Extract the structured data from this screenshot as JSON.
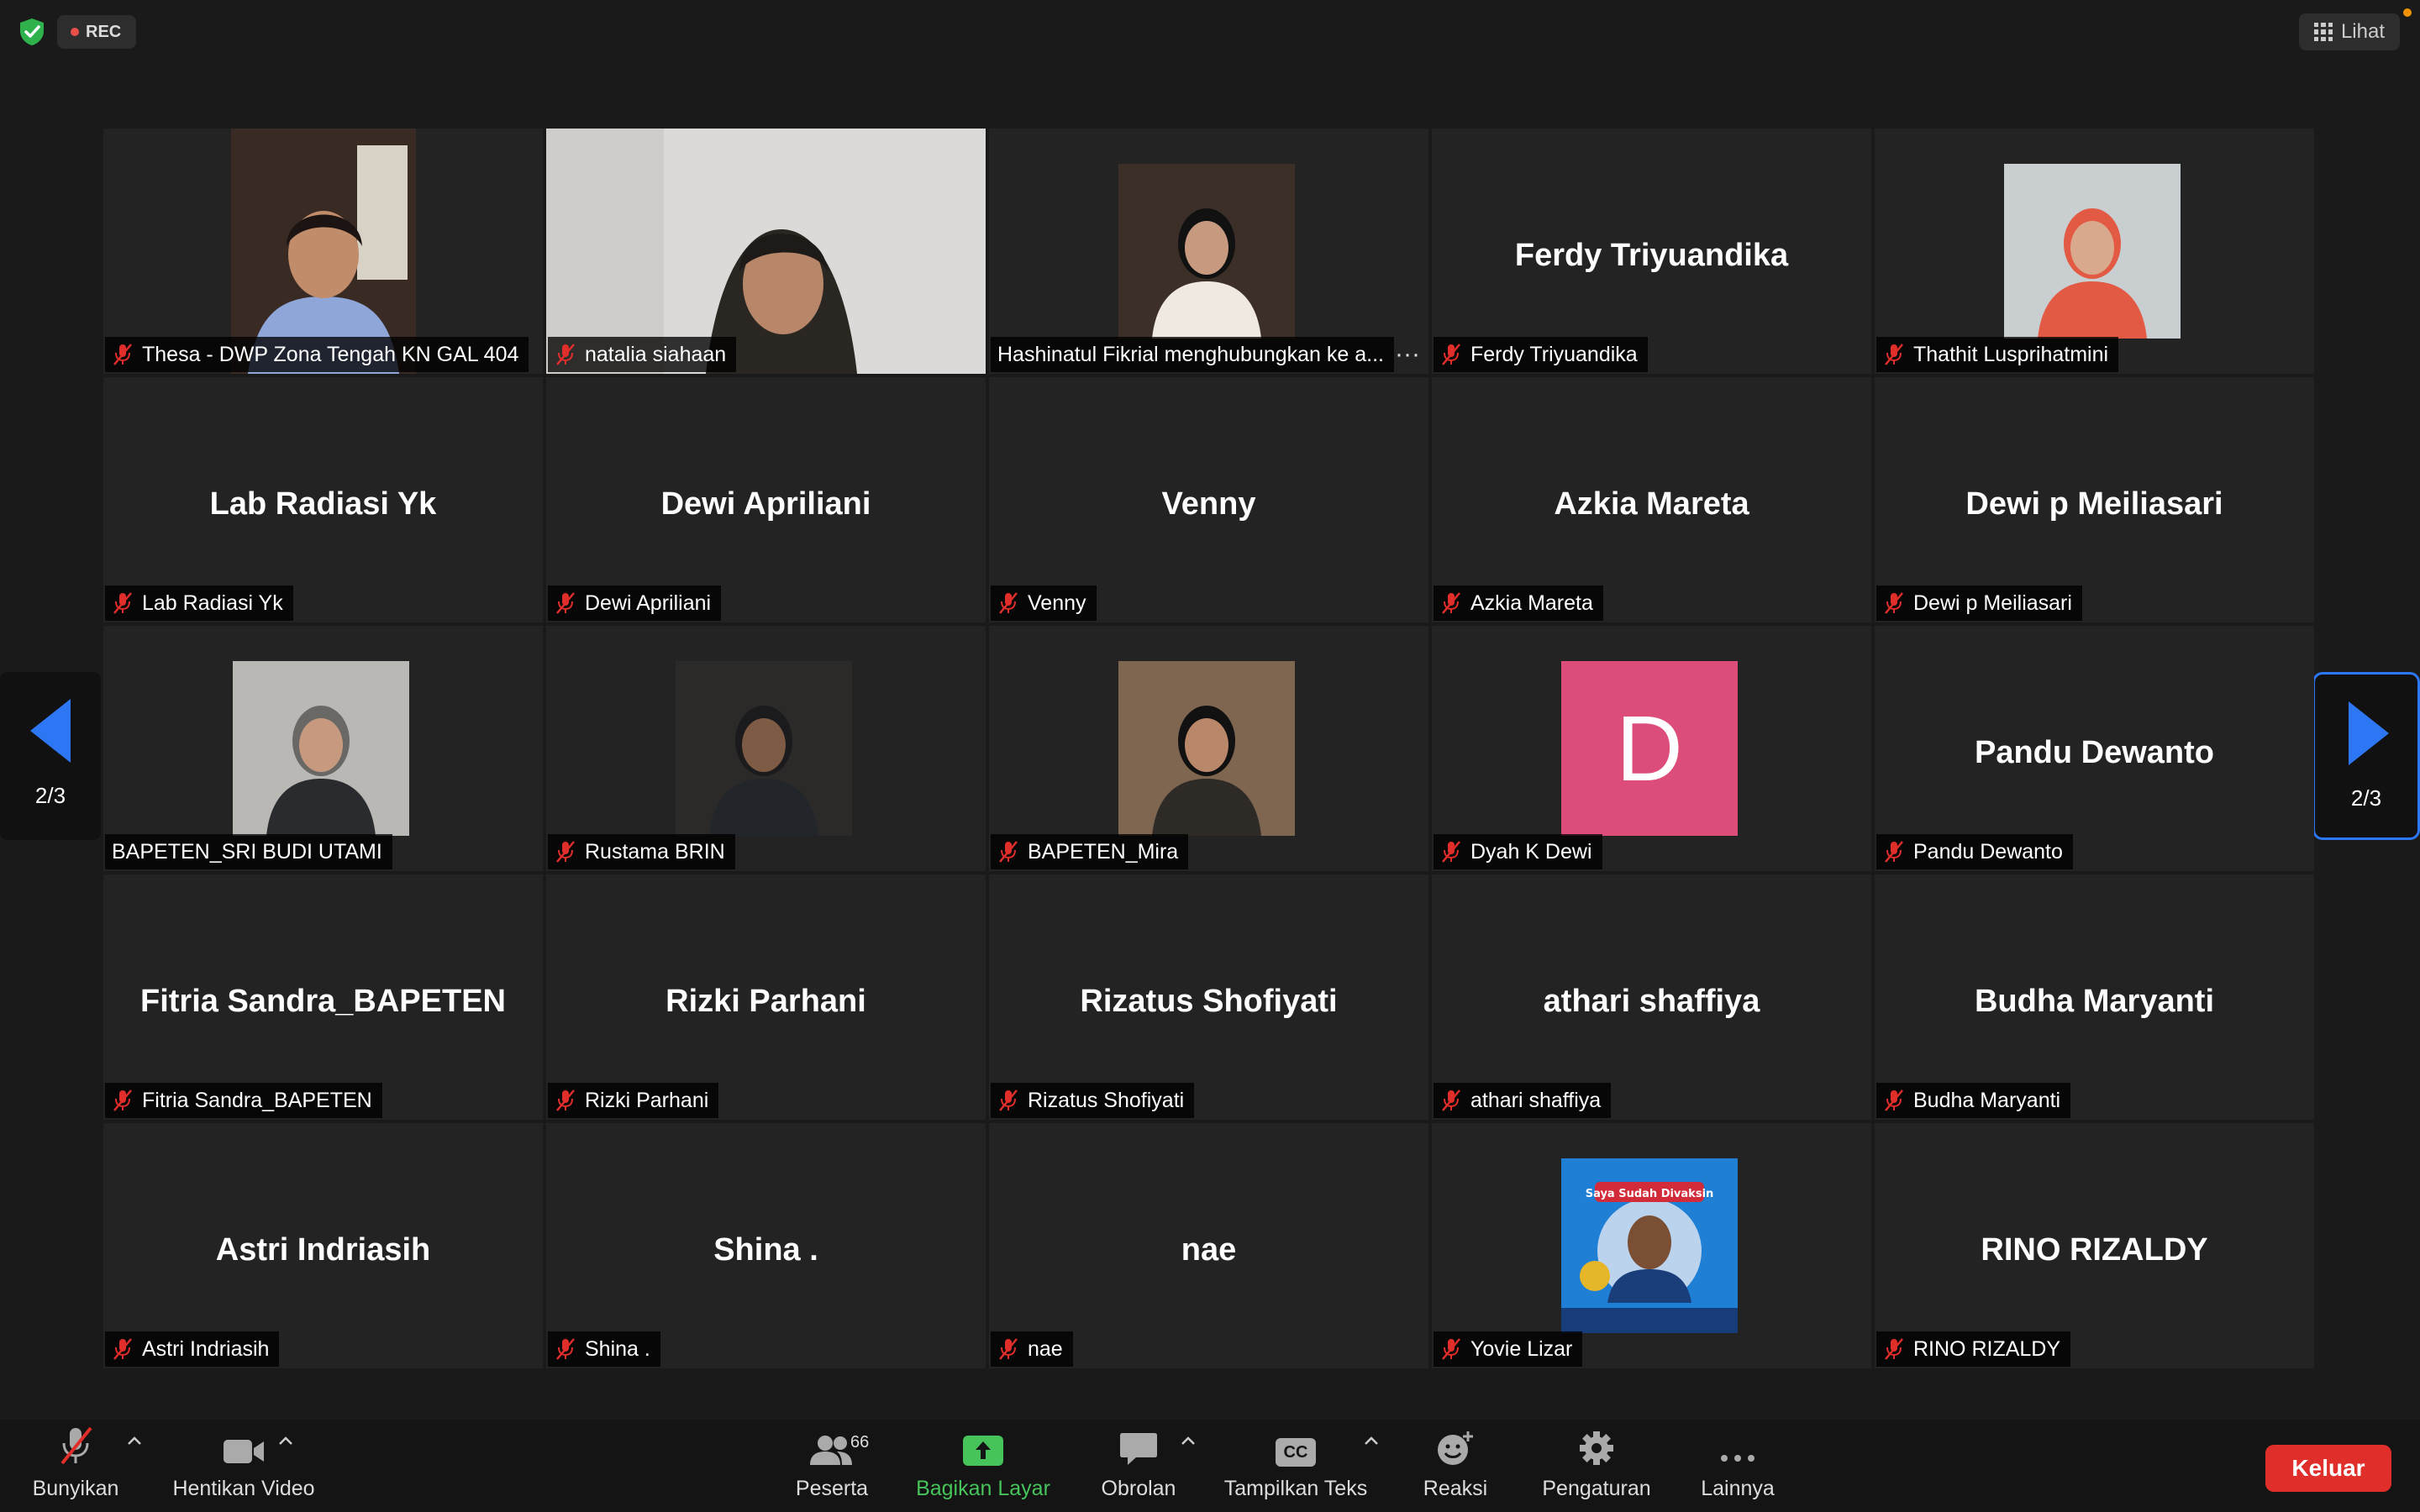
{
  "header": {
    "rec_label": "REC",
    "view_label": "Lihat"
  },
  "pager": {
    "left_page": "2/3",
    "right_page": "2/3"
  },
  "tiles": [
    {
      "name": "Thesa - DWP Zona Tengah KN GAL 404",
      "display": "",
      "muted": true,
      "photo": "thesa"
    },
    {
      "name": "natalia siahaan",
      "display": "",
      "muted": true,
      "photo": "natalia"
    },
    {
      "name": "Hashinatul Fikrial menghubungkan ke a...",
      "display": "",
      "muted": false,
      "photo": "hijab"
    },
    {
      "name": "Ferdy Triyuandika",
      "display": "Ferdy Triyuandika",
      "muted": true,
      "photo": ""
    },
    {
      "name": "Thathit Lusprihatmini",
      "display": "",
      "muted": true,
      "photo": "thathit"
    },
    {
      "name": "Lab Radiasi Yk",
      "display": "Lab Radiasi Yk",
      "muted": true,
      "photo": ""
    },
    {
      "name": "Dewi Apriliani",
      "display": "Dewi Apriliani",
      "muted": true,
      "photo": ""
    },
    {
      "name": "Venny",
      "display": "Venny",
      "muted": true,
      "photo": ""
    },
    {
      "name": "Azkia Mareta",
      "display": "Azkia Mareta",
      "muted": true,
      "photo": ""
    },
    {
      "name": "Dewi p Meiliasari",
      "display": "Dewi p Meiliasari",
      "muted": true,
      "photo": ""
    },
    {
      "name": "BAPETEN_SRI BUDI UTAMI",
      "display": "",
      "muted": false,
      "photo": "sri"
    },
    {
      "name": "Rustama BRIN",
      "display": "",
      "muted": true,
      "photo": "rustama"
    },
    {
      "name": "BAPETEN_Mira",
      "display": "",
      "muted": true,
      "photo": "mira"
    },
    {
      "name": "Dyah K Dewi",
      "display": "",
      "muted": true,
      "photo": "letter",
      "letter": "D"
    },
    {
      "name": "Pandu Dewanto",
      "display": "Pandu Dewanto",
      "muted": true,
      "photo": ""
    },
    {
      "name": "Fitria Sandra_BAPETEN",
      "display": "Fitria Sandra_BAPETEN",
      "muted": true,
      "photo": ""
    },
    {
      "name": "Rizki Parhani",
      "display": "Rizki Parhani",
      "muted": true,
      "photo": ""
    },
    {
      "name": "Rizatus Shofiyati",
      "display": "Rizatus Shofiyati",
      "muted": true,
      "photo": ""
    },
    {
      "name": "athari shaffiya",
      "display": "athari shaffiya",
      "muted": true,
      "photo": ""
    },
    {
      "name": "Budha Maryanti",
      "display": "Budha Maryanti",
      "muted": true,
      "photo": ""
    },
    {
      "name": "Astri Indriasih",
      "display": "Astri Indriasih",
      "muted": true,
      "photo": ""
    },
    {
      "name": "Shina .",
      "display": "Shina .",
      "muted": true,
      "photo": ""
    },
    {
      "name": "nae",
      "display": "nae",
      "muted": true,
      "photo": ""
    },
    {
      "name": "Yovie Lizar",
      "display": "",
      "muted": true,
      "photo": "poster",
      "poster_text": "Saya Sudah Divaksin"
    },
    {
      "name": "RINO RIZALDY",
      "display": "RINO RIZALDY",
      "muted": true,
      "photo": ""
    }
  ],
  "toolbar": {
    "unmute": "Bunyikan",
    "stop_video": "Hentikan Video",
    "participants": "Peserta",
    "participants_count": "66",
    "share": "Bagikan Layar",
    "chat": "Obrolan",
    "captions": "Tampilkan Teks",
    "captions_icon_text": "CC",
    "reactions": "Reaksi",
    "settings": "Pengaturan",
    "more": "Lainnya",
    "leave": "Keluar"
  },
  "colors": {
    "muted_mic": "#e02e2a",
    "share_green": "#46c35a",
    "pager_border": "#2d77f5",
    "leave_red": "#e02e2a",
    "avatar_pink": "#dd4d7a"
  }
}
